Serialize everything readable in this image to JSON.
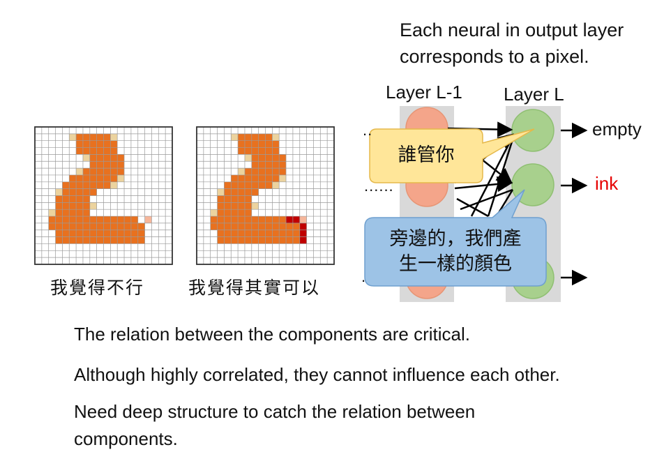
{
  "description": {
    "line1": "Each neural in output layer",
    "line2": "corresponds to a pixel."
  },
  "layers": {
    "prev": "Layer L-1",
    "current": "Layer L"
  },
  "outputs": {
    "empty": "empty",
    "ink": "ink"
  },
  "dots": "......",
  "captions": {
    "left": "我覺得不行",
    "right": "我覺得其實可以"
  },
  "callouts": {
    "top": "誰管你",
    "bottom_line1": "旁邊的，我們產",
    "bottom_line2": "生一樣的顏色"
  },
  "body": {
    "line1": "The relation between the components are critical.",
    "line2": "Although highly correlated, they cannot influence each other.",
    "line3": "Need deep structure to catch the relation between",
    "line4": "components."
  },
  "colors": {
    "ink": "#e8711f",
    "faint": "#ecd39e",
    "light_red": "#f6b69a",
    "dark_red": "#c00000",
    "hidden_node": "#f4a58a",
    "output_node": "#a8d08d",
    "column_bg": "#d9d9d9",
    "callout_yellow": "#ffe699",
    "callout_blue": "#9dc3e6",
    "ink_label": "#e60000"
  }
}
